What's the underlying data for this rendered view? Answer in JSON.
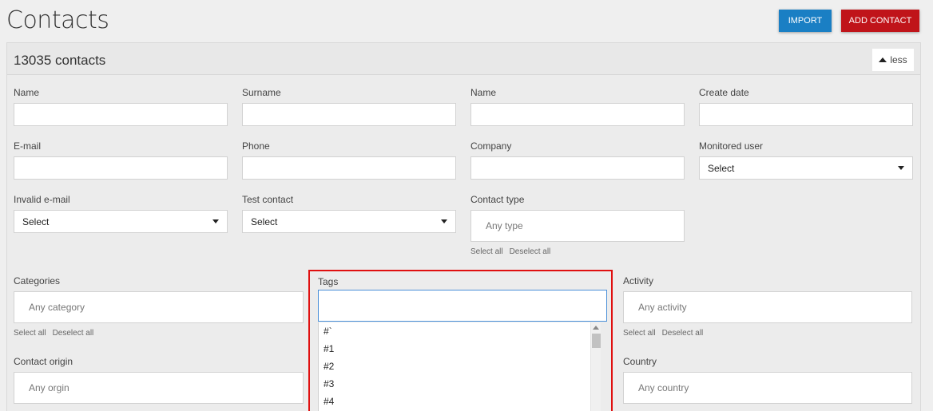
{
  "page": {
    "title": "Contacts"
  },
  "toolbar": {
    "import_label": "IMPORT",
    "add_contact_label": "ADD CONTACT",
    "import_color": "#1a7fc4",
    "add_color": "#c0141a"
  },
  "panel": {
    "count": "13035 contacts",
    "less_label": "less"
  },
  "filters": {
    "name1": "Name",
    "surname": "Surname",
    "name2": "Name",
    "create_date": "Create date",
    "email": "E-mail",
    "phone": "Phone",
    "company": "Company",
    "monitored_user": {
      "label": "Monitored user",
      "value": "Select"
    },
    "invalid_email": {
      "label": "Invalid e-mail",
      "value": "Select"
    },
    "test_contact": {
      "label": "Test contact",
      "value": "Select"
    },
    "contact_type": {
      "label": "Contact type",
      "placeholder": "Any type"
    },
    "categories": {
      "label": "Categories",
      "placeholder": "Any category"
    },
    "tags": {
      "label": "Tags",
      "options": [
        "#`",
        "#1",
        "#2",
        "#3",
        "#4"
      ]
    },
    "activity": {
      "label": "Activity",
      "placeholder": "Any activity"
    },
    "contact_origin": {
      "label": "Contact origin",
      "placeholder": "Any orgin"
    },
    "country": {
      "label": "Country",
      "placeholder": "Any country"
    }
  },
  "links": {
    "select_all": "Select all",
    "deselect_all": "Deselect all"
  },
  "highlight_color": "#e01010"
}
